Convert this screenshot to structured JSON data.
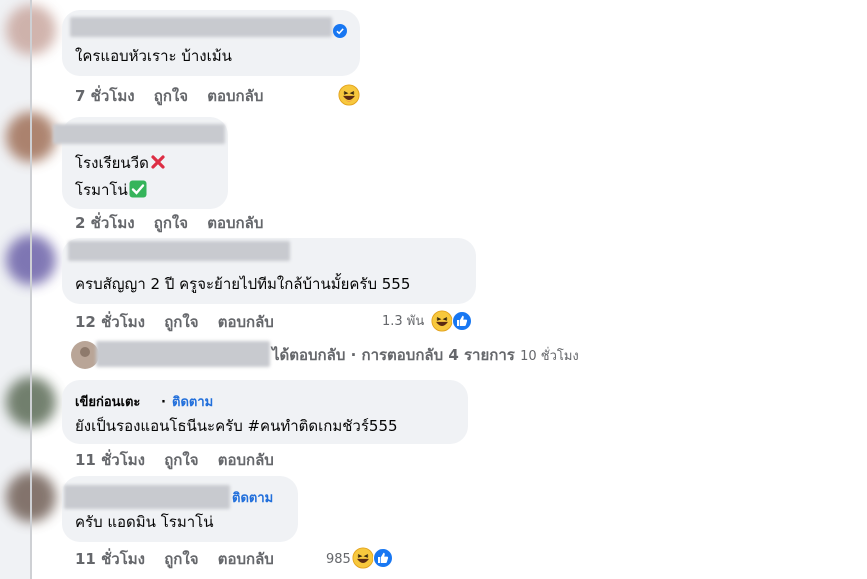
{
  "comments": [
    {
      "text": "ใครแอบหัวเราะ บ้างเม้น",
      "time": "7 ชั่วโมง"
    },
    {
      "lines": [
        "โรงเรียนวีด",
        "โรมาโน่"
      ],
      "time": "2 ชั่วโมง"
    },
    {
      "text": "ครบสัญญา 2 ปี ครูจะย้ายไปทีมใกล้บ้านมั้ยครับ 555",
      "time": "12 ชั่วโมง",
      "reactions": "1.3 พัน"
    },
    {
      "name": "เขียก่อนเตะ",
      "follow": "ติดตาม",
      "text": "ยังเป็นรองแอนโธนีนะครับ #คนทำติดเกมชัวร์555",
      "time": "11 ชั่วโมง"
    },
    {
      "follow": "ติดตาม",
      "text": "ครับ แอดมิน โรมาโน่",
      "time": "11 ชั่วโมง",
      "reactions": "985"
    }
  ],
  "actions": {
    "like": "ถูกใจ",
    "reply": "ตอบกลับ"
  },
  "reply_summary": {
    "text": "ได้ตอบกลับ · การตอบกลับ 4 รายการ",
    "time": "10 ชั่วโมง"
  },
  "separator": "·",
  "icons": [
    "verified-badge-icon",
    "haha-emoji-icon",
    "like-reaction-icon",
    "cross-mark-icon",
    "check-mark-icon"
  ],
  "colors": {
    "bubble": "#f0f2f5",
    "link": "#216fdb",
    "meta": "#65676b",
    "like_blue": "#1877f2"
  }
}
